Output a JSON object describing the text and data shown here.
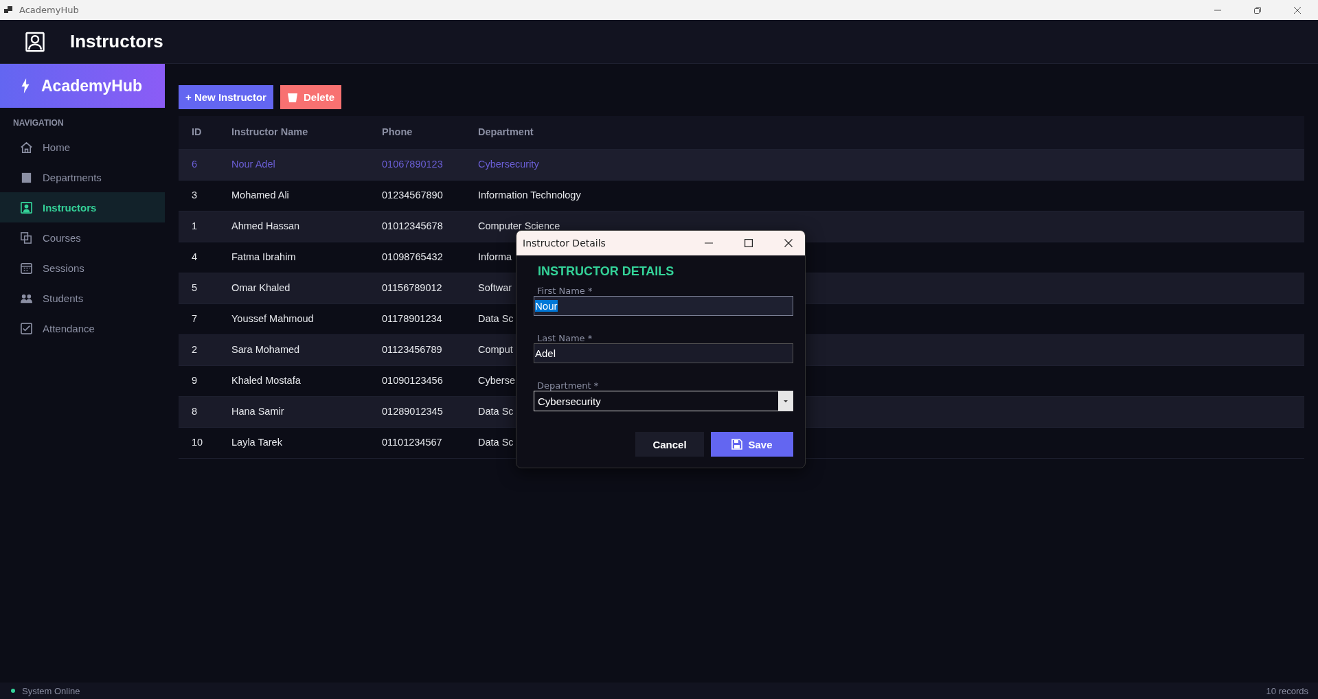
{
  "window": {
    "title": "AcademyHub"
  },
  "header": {
    "title": "Instructors"
  },
  "sidebar": {
    "brand": "AcademyHub",
    "section": "NAVIGATION",
    "items": [
      {
        "label": "Home",
        "selected": false
      },
      {
        "label": "Departments",
        "selected": false
      },
      {
        "label": "Instructors",
        "selected": true
      },
      {
        "label": "Courses",
        "selected": false
      },
      {
        "label": "Sessions",
        "selected": false
      },
      {
        "label": "Students",
        "selected": false
      },
      {
        "label": "Attendance",
        "selected": false
      }
    ]
  },
  "toolbar": {
    "new_button": "+ New Instructor",
    "delete_button": "Delete"
  },
  "table": {
    "columns": [
      "ID",
      "Instructor Name",
      "Phone",
      "Department"
    ],
    "rows": [
      {
        "cells": [
          "6",
          "Nour Adel",
          "01067890123",
          "Cybersecurity"
        ],
        "selected": true
      },
      {
        "cells": [
          "3",
          "Mohamed Ali",
          "01234567890",
          "Information Technology"
        ],
        "selected": false
      },
      {
        "cells": [
          "1",
          "Ahmed Hassan",
          "01012345678",
          "Computer Science"
        ],
        "selected": false
      },
      {
        "cells": [
          "4",
          "Fatma Ibrahim",
          "01098765432",
          "Informa"
        ],
        "selected": false
      },
      {
        "cells": [
          "5",
          "Omar Khaled",
          "01156789012",
          "Softwar"
        ],
        "selected": false
      },
      {
        "cells": [
          "7",
          "Youssef Mahmoud",
          "01178901234",
          "Data Sc"
        ],
        "selected": false
      },
      {
        "cells": [
          "2",
          "Sara Mohamed",
          "01123456789",
          "Comput"
        ],
        "selected": false
      },
      {
        "cells": [
          "9",
          "Khaled Mostafa",
          "01090123456",
          "Cyberse"
        ],
        "selected": false
      },
      {
        "cells": [
          "8",
          "Hana Samir",
          "01289012345",
          "Data Sc"
        ],
        "selected": false
      },
      {
        "cells": [
          "10",
          "Layla Tarek",
          "01101234567",
          "Data Sc"
        ],
        "selected": false
      }
    ]
  },
  "dialog": {
    "title": "Instructor Details",
    "heading": "INSTRUCTOR DETAILS",
    "fields": [
      {
        "label": "First Name *",
        "value": "Nour",
        "kind": "text",
        "selected": true
      },
      {
        "label": "Last Name *",
        "value": "Adel",
        "kind": "text",
        "selected": false
      },
      {
        "label": "Department *",
        "value": "Cybersecurity",
        "kind": "dropdown",
        "selected": false
      }
    ],
    "cancel_button": "Cancel",
    "save_button": "Save"
  },
  "status_bar": {
    "status": "System Online",
    "count": "10 records"
  }
}
